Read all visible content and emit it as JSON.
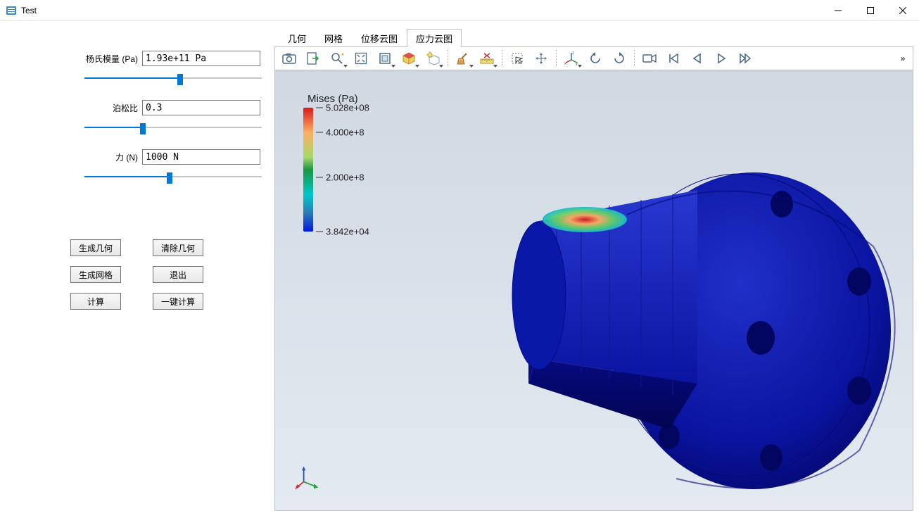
{
  "window": {
    "title": "Test"
  },
  "params": {
    "youngs_label": "杨氏模量 (Pa)",
    "youngs_value": "1.93e+11 Pa",
    "youngs_slider_pct": 54,
    "poisson_label": "泊松比",
    "poisson_value": "0.3",
    "poisson_slider_pct": 33,
    "force_label": "力 (N)",
    "force_value": "1000 N",
    "force_slider_pct": 48
  },
  "buttons": {
    "gen_geom": "生成几何",
    "clear_geom": "清除几何",
    "gen_mesh": "生成网格",
    "exit": "退出",
    "compute": "计算",
    "one_click": "一键计算"
  },
  "tabs": {
    "geom": "几何",
    "mesh": "网格",
    "disp": "位移云图",
    "stress": "应力云图",
    "active": "stress"
  },
  "legend": {
    "title": "Mises (Pa)",
    "ticks": [
      {
        "label": "5.028e+08",
        "pct": 0
      },
      {
        "label": "4.000e+8",
        "pct": 20
      },
      {
        "label": "2.000e+8",
        "pct": 56
      },
      {
        "label": "3.842e+04",
        "pct": 100
      }
    ]
  },
  "overflow": "»"
}
